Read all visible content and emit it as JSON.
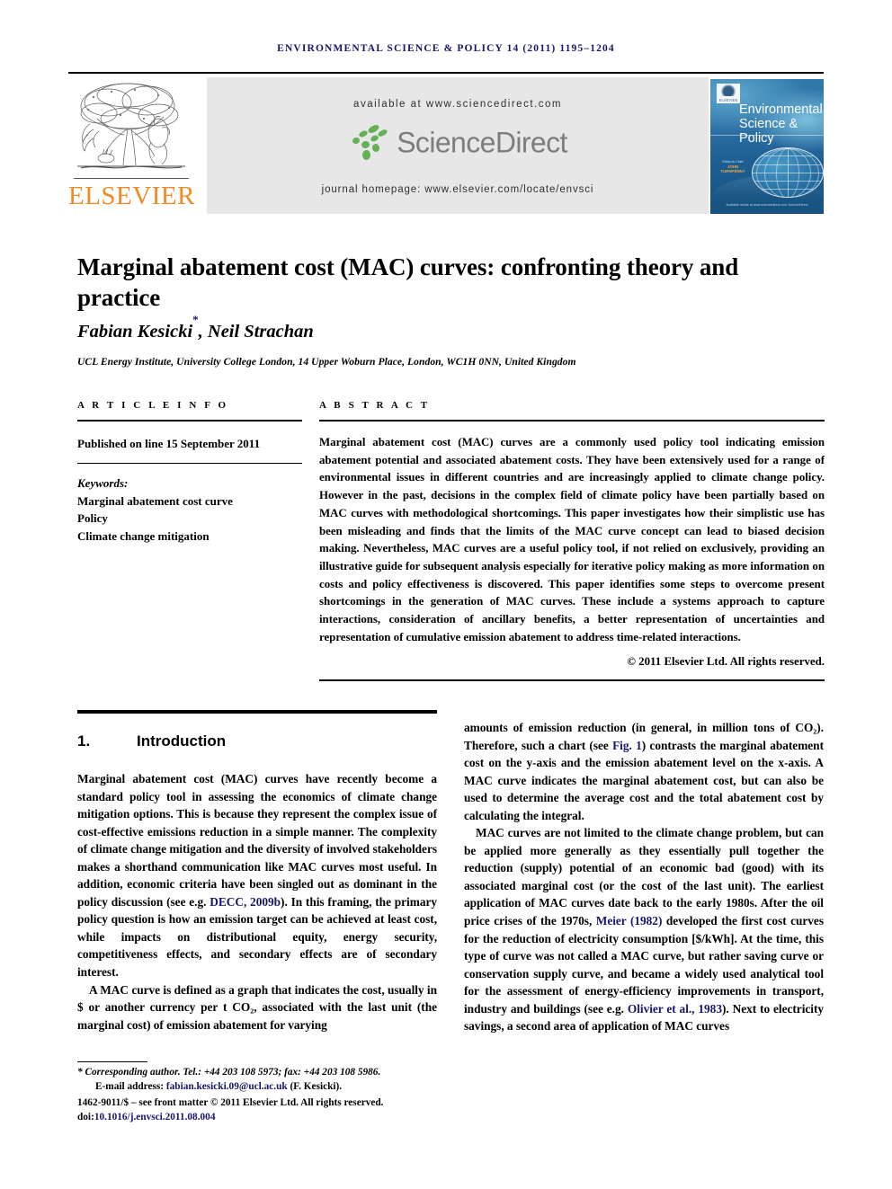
{
  "running_head": "ENVIRONMENTAL SCIENCE & POLICY 14 (2011) 1195–1204",
  "banner": {
    "available_at": "available at www.sciencedirect.com",
    "journal_homepage": "journal homepage: www.elsevier.com/locate/envsci",
    "sciencedirect_logo_text": "ScienceDirect",
    "publisher_logo_text": "ELSEVIER"
  },
  "cover": {
    "line1": "Environmental",
    "line2": "Science &",
    "line3": "Policy",
    "editor_label": "Editor-in-Chief",
    "editor_name": "JOHN TURNPENNY",
    "footer": "Available online at www.sciencedirect.com ScienceDirect"
  },
  "article": {
    "title": "Marginal abatement cost (MAC) curves: confronting theory and practice",
    "authors": "Fabian Kesicki, Neil Strachan",
    "corresponding_marker": "*",
    "affiliation": "UCL Energy Institute, University College London, 14 Upper Woburn Place, London, WC1H 0NN, United Kingdom"
  },
  "article_info": {
    "heading": "A R T I C L E  I N F O",
    "published": "Published on line 15 September 2011",
    "keywords_label": "Keywords:",
    "keywords": [
      "Marginal abatement cost curve",
      "Policy",
      "Climate change mitigation"
    ]
  },
  "abstract": {
    "heading": "A B S T R A C T",
    "text": "Marginal abatement cost (MAC) curves are a commonly used policy tool indicating emission abatement potential and associated abatement costs. They have been extensively used for a range of environmental issues in different countries and are increasingly applied to climate change policy. However in the past, decisions in the complex field of climate policy have been partially based on MAC curves with methodological shortcomings. This paper investigates how their simplistic use has been misleading and finds that the limits of the MAC curve concept can lead to biased decision making. Nevertheless, MAC curves are a useful policy tool, if not relied on exclusively, providing an illustrative guide for subsequent analysis especially for iterative policy making as more information on costs and policy effectiveness is discovered. This paper identifies some steps to overcome present shortcomings in the generation of MAC curves. These include a systems approach to capture interactions, consideration of ancillary benefits, a better representation of uncertainties and representation of cumulative emission abatement to address time-related interactions.",
    "copyright": "© 2011 Elsevier Ltd. All rights reserved."
  },
  "section": {
    "number": "1.",
    "title": "Introduction"
  },
  "body": {
    "left_p1_a": "Marginal abatement cost (MAC) curves have recently become a standard policy tool in assessing the economics of climate change mitigation options. This is because they represent the complex issue of cost-effective emissions reduction in a simple manner. The complexity of climate change mitigation and the diversity of involved stakeholders makes a shorthand communication like MAC curves most useful. In addition, economic criteria have been singled out as dominant in the policy discussion (see e.g. ",
    "left_p1_ref": "DECC, 2009b",
    "left_p1_b": "). In this framing, the primary policy question is how an emission target can be achieved at least cost, while impacts on distributional equity, energy security, competitiveness effects, and secondary effects are of secondary interest.",
    "left_p2": "A MAC curve is defined as a graph that indicates the cost, usually in $ or another currency per t CO₂, associated with the last unit (the marginal cost) of emission abatement for varying",
    "right_p1_a": "amounts of emission reduction (in general, in million tons of CO₂). Therefore, such a chart (see ",
    "right_p1_ref": "Fig. 1",
    "right_p1_b": ") contrasts the marginal abatement cost on the y-axis and the emission abatement level on the x-axis. A MAC curve indicates the marginal abatement cost, but can also be used to determine the average cost and the total abatement cost by calculating the integral.",
    "right_p2_a": "MAC curves are not limited to the climate change problem, but can be applied more generally as they essentially pull together the reduction (supply) potential of an economic bad (good) with its associated marginal cost (or the cost of the last unit). The earliest application of MAC curves date back to the early 1980s. After the oil price crises of the 1970s, ",
    "right_p2_ref1": "Meier (1982)",
    "right_p2_b": " developed the first cost curves for the reduction of electricity consumption [$/kWh]. At the time, this type of curve was not called a MAC curve, but rather saving curve or conservation supply curve, and became a widely used analytical tool for the assessment of energy-efficiency improvements in transport, industry and buildings (see e.g. ",
    "right_p2_ref2": "Olivier et al., 1983",
    "right_p2_c": "). Next to electricity savings, a second area of application of MAC curves"
  },
  "footnote": {
    "corresponding": "* Corresponding author. Tel.: +44 203 108 5973; fax: +44 203 108 5986.",
    "email_label": "E-mail address: ",
    "email": "fabian.kesicki.09@ucl.ac.uk",
    "email_suffix": " (F. Kesicki).",
    "issn_line": "1462-9011/$ – see front matter © 2011 Elsevier Ltd. All rights reserved.",
    "doi_label": "doi:",
    "doi": "10.1016/j.envsci.2011.08.004"
  },
  "colors": {
    "link": "#16166b",
    "elsevier_orange": "#f08a22",
    "sciencedirect_green": "#64b054",
    "banner_grey": "#e7e7e8",
    "cover_blue": "#1a5e92"
  }
}
